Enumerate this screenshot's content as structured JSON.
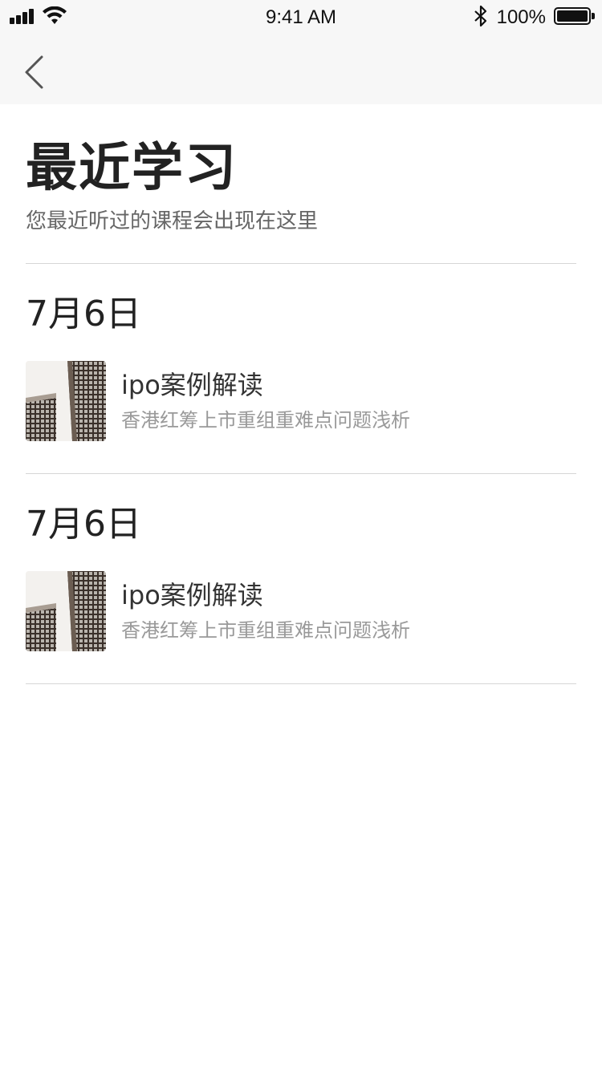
{
  "status_bar": {
    "time": "9:41 AM",
    "battery": "100%",
    "icons": [
      "signal-icon",
      "wifi-icon",
      "bluetooth-icon",
      "battery-icon"
    ]
  },
  "nav": {
    "back_icon": "chevron-left-icon"
  },
  "page": {
    "title": "最近学习",
    "subtitle": "您最近听过的课程会出现在这里"
  },
  "sections": [
    {
      "date": "7月6日",
      "course": {
        "title": "ipo案例解读",
        "subtitle": "香港红筹上市重组重难点问题浅析",
        "thumbnail": "building-facade-image"
      }
    },
    {
      "date": "7月6日",
      "course": {
        "title": "ipo案例解读",
        "subtitle": "香港红筹上市重组重难点问题浅析",
        "thumbnail": "building-facade-image"
      }
    }
  ],
  "colors": {
    "bar_bg": "#f7f7f7",
    "text_primary": "#222222",
    "text_secondary": "#999999",
    "divider": "#d6d6d6"
  }
}
